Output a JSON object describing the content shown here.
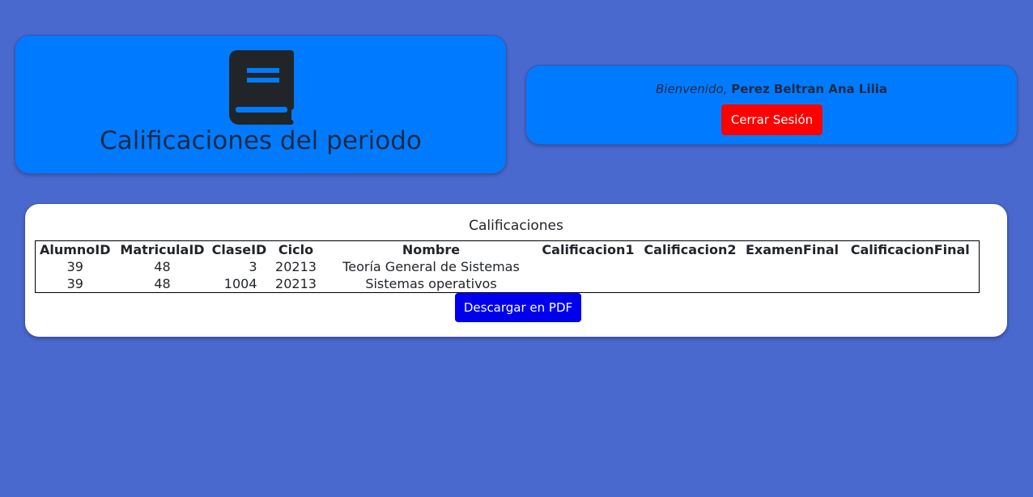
{
  "header": {
    "icon": "book-icon",
    "title": "Calificaciones del periodo"
  },
  "user": {
    "welcome_label": "Bienvenido,",
    "name": "Perez Beltran Ana Lilia",
    "logout_label": "Cerrar Sesión"
  },
  "grades": {
    "caption": "Calificaciones",
    "columns": [
      "AlumnoID",
      "MatriculaID",
      "ClaseID",
      "Ciclo",
      "Nombre",
      "Calificacion1",
      "Calificacion2",
      "ExamenFinal",
      "CalificacionFinal"
    ],
    "rows": [
      [
        "39",
        "48",
        "3",
        "20213",
        "Teoría General de Sistemas",
        "",
        "",
        "",
        ""
      ],
      [
        "39",
        "48",
        "1004",
        "20213",
        "Sistemas operativos",
        "",
        "",
        "",
        ""
      ]
    ],
    "download_label": "Descargar en PDF"
  },
  "colors": {
    "background": "#4a69cf",
    "card": "#007bff",
    "logout": "#ff0000",
    "download": "#0000ee"
  }
}
